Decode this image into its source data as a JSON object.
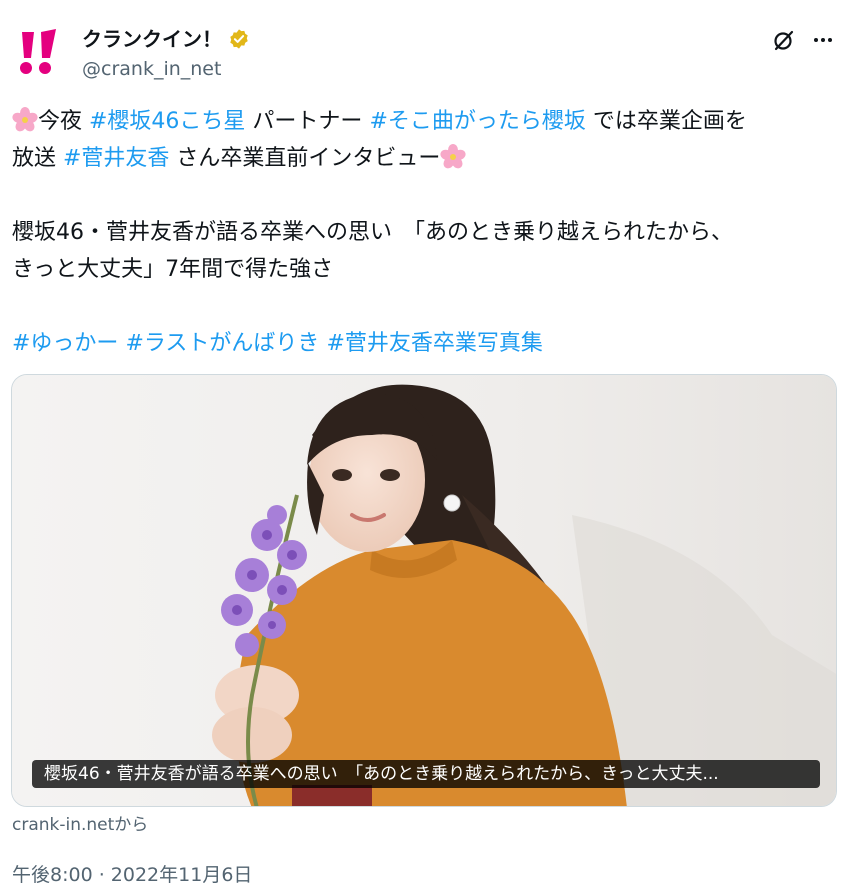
{
  "account": {
    "display_name": "クランクイン！",
    "handle": "@crank_in_net",
    "logo_icon": "crank-in-logo-icon",
    "verified_icon": "gold-verified-badge-icon"
  },
  "actions": {
    "grok_icon": "grok-icon",
    "more_icon": "more-dots-icon"
  },
  "text": {
    "line1": {
      "emoji": "cherry-blossom",
      "seg1": "今夜 ",
      "tag1": "#櫻坂46こち星",
      "seg2": " パートナー ",
      "tag2": "#そこ曲がったら櫻坂",
      "seg3": " では卒業企画を"
    },
    "line2": {
      "seg1": "放送 ",
      "tag1": "#菅井友香",
      "seg2": " さん卒業直前インタビュー",
      "emoji": "cherry-blossom"
    },
    "line3": "櫻坂46・菅井友香が語る卒業への思い　「あのとき乗り越えられたから、",
    "line4": "きっと大丈夫」7年間で得た強さ",
    "hashtags": [
      "#ゆっかー",
      "#ラストがんばりき",
      "#菅井友香卒業写真集"
    ]
  },
  "card": {
    "caption": "櫻坂46・菅井友香が語る卒業への思い　「あのとき乗り越えられたから、きっと大丈夫...",
    "source": "crank-in.netから"
  },
  "timestamp": "午後8:00 · 2022年11月6日",
  "colors": {
    "link": "#1d9bf0",
    "secondary_text": "#536471",
    "logo_pink": "#e4007f",
    "sweater": "#d98a2e"
  }
}
